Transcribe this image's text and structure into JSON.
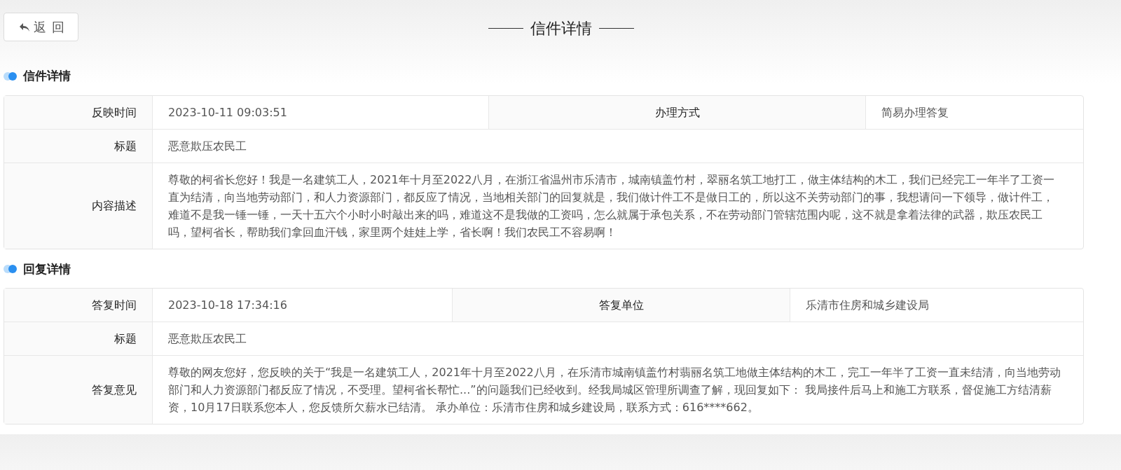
{
  "back_button": {
    "label": "返 回"
  },
  "page_title": "信件详情",
  "sections": [
    {
      "heading": "信件详情",
      "rows": [
        {
          "cells": [
            {
              "kind": "label",
              "text": "反映时间"
            },
            {
              "kind": "value",
              "text": "2023-10-11 09:03:51"
            },
            {
              "kind": "label",
              "text": "办理方式"
            },
            {
              "kind": "value",
              "text": "简易办理答复"
            }
          ]
        },
        {
          "cells": [
            {
              "kind": "label",
              "text": "标题"
            },
            {
              "kind": "value",
              "colspan": 3,
              "text": "恶意欺压农民工"
            }
          ]
        },
        {
          "cells": [
            {
              "kind": "label",
              "text": "内容描述"
            },
            {
              "kind": "value",
              "colspan": 3,
              "text": "尊敬的柯省长您好！我是一名建筑工人，2021年十月至2022八月，在浙江省温州市乐清市，城南镇盖竹村，翠丽名筑工地打工，做主体结构的木工，我们已经完工一年半了工资一直为结清，向当地劳动部门，和人力资源部门，都反应了情况，当地相关部门的回复就是，我们做计件工不是做日工的，所以这不关劳动部门的事，我想请问一下领导，做计件工，难道不是我一锤一锤，一天十五六个小时小时敲出来的吗，难道这不是我做的工资吗，怎么就属于承包关系，不在劳动部门管辖范围内呢，这不就是拿着法律的武器，欺压农民工吗，望柯省长，帮助我们拿回血汗钱，家里两个娃娃上学，省长啊！我们农民工不容易啊！"
            }
          ]
        }
      ]
    },
    {
      "heading": "回复详情",
      "rows": [
        {
          "cells": [
            {
              "kind": "label",
              "text": "答复时间"
            },
            {
              "kind": "value",
              "text": "2023-10-18 17:34:16"
            },
            {
              "kind": "label",
              "text": "答复单位"
            },
            {
              "kind": "value",
              "text": "乐清市住房和城乡建设局"
            }
          ]
        },
        {
          "cells": [
            {
              "kind": "label",
              "text": "标题"
            },
            {
              "kind": "value",
              "colspan": 3,
              "text": "恶意欺压农民工"
            }
          ]
        },
        {
          "cells": [
            {
              "kind": "label",
              "text": "答复意见"
            },
            {
              "kind": "value",
              "colspan": 3,
              "text": "尊敬的网友您好，您反映的关于“我是一名建筑工人，2021年十月至2022八月，在乐清市城南镇盖竹村翡丽名筑工地做主体结构的木工，完工一年半了工资一直未结清，向当地劳动部门和人力资源部门都反应了情况，不受理。望柯省长帮忙...”的问题我们已经收到。经我局城区管理所调查了解，现回复如下： 我局接件后马上和施工方联系，督促施工方结清薪资，10月17日联系您本人，您反馈所欠薪水已结清。 承办单位：乐清市住房和城乡建设局，联系方式：616****662。"
            }
          ]
        }
      ]
    }
  ]
}
